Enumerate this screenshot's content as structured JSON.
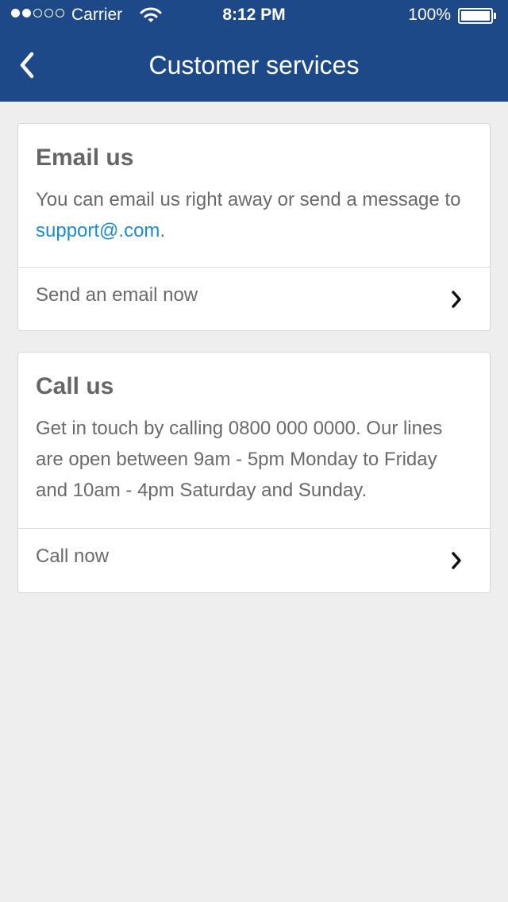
{
  "status_bar": {
    "carrier": "Carrier",
    "time": "8:12 PM",
    "battery": "100%",
    "signal_bars_filled": 2,
    "signal_bars_total": 5
  },
  "nav": {
    "title": "Customer services",
    "back_icon": "chevron-left-icon"
  },
  "email_card": {
    "title": "Email us",
    "text_before": "You can email us right away or send a message to ",
    "email_link": "support@.com",
    "text_after": ".",
    "action_label": "Send an email now",
    "action_icon": "chevron-right-icon"
  },
  "call_card": {
    "title": "Call us",
    "text": "Get in touch by calling 0800 000 0000. Our lines are open between 9am - 5pm Monday to Friday and 10am - 4pm Saturday and Sunday.",
    "action_label": "Call now",
    "action_icon": "chevron-right-icon"
  },
  "colors": {
    "header": "#1d4989",
    "link": "#1d8ad0",
    "background": "#eeeeee"
  }
}
